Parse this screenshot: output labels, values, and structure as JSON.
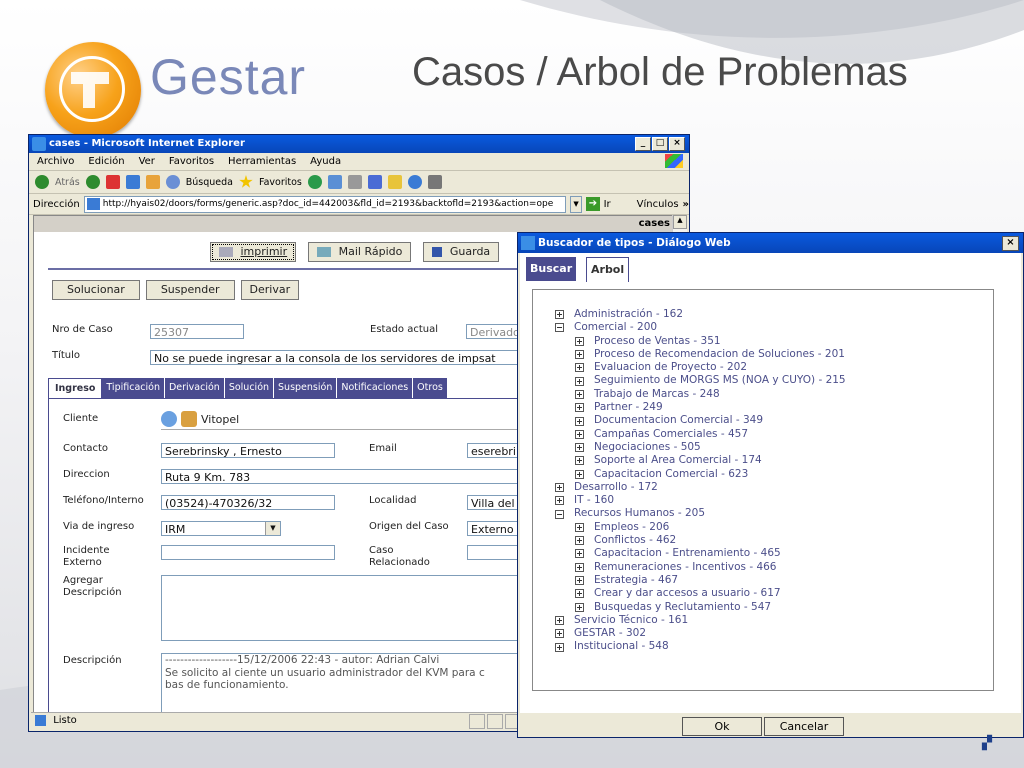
{
  "slide": {
    "brand": "Gestar",
    "title": "Casos / Arbol de Problemas"
  },
  "browser": {
    "window_title": "cases - Microsoft Internet Explorer",
    "menu": [
      "Archivo",
      "Edición",
      "Ver",
      "Favoritos",
      "Herramientas",
      "Ayuda"
    ],
    "toolbar": {
      "back": "Atrás",
      "search": "Búsqueda",
      "favorites": "Favoritos"
    },
    "address_label": "Dirección",
    "address_value": "http://hyais02/doors/forms/generic.asp?doc_id=442003&fld_id=2193&backtofld=2193&action=ope",
    "go_label": "Ir",
    "links_label": "Vínculos",
    "status": "Listo"
  },
  "form": {
    "header_label": "cases",
    "buttons_top": {
      "print": "imprimir",
      "mail": "Mail Rápido",
      "save": "Guarda"
    },
    "actions": [
      "Solucionar",
      "Suspender",
      "Derivar"
    ],
    "nro_caso_label": "Nro de Caso",
    "nro_caso_value": "25307",
    "estado_label": "Estado actual",
    "estado_value": "Derivado",
    "titulo_label": "Título",
    "titulo_value": "No se puede ingresar a la consola de los servidores de impsat",
    "tabs": [
      "Ingreso",
      "Tipificación",
      "Derivación",
      "Solución",
      "Suspensión",
      "Notificaciones",
      "Otros"
    ],
    "cliente_label": "Cliente",
    "cliente_value": "Vitopel",
    "contacto_label": "Contacto",
    "contacto_value": "Serebrinsky , Ernesto",
    "email_label": "Email",
    "email_value": "eserebri",
    "direccion_label": "Direccion",
    "direccion_value": "Ruta 9 Km. 783",
    "telefono_label": "Teléfono/Interno",
    "telefono_value": "(03524)-470326/32",
    "localidad_label": "Localidad",
    "localidad_value": "Villa del",
    "via_label": "Via de ingreso",
    "via_value": "IRM",
    "origen_label": "Origen del Caso",
    "origen_value": "Externo -",
    "incidente_label_1": "Incidente",
    "incidente_label_2": "Externo",
    "caso_rel_label_1": "Caso",
    "caso_rel_label_2": "Relacionado",
    "agregar_label_1": "Agregar",
    "agregar_label_2": "Descripción",
    "descripcion_label": "Descripción",
    "descripcion_line1": "-------------------15/12/2006 22:43 - autor: Adrian Calvi",
    "descripcion_line2": "Se solicito al ciente un usuario administrador del KVM para c",
    "descripcion_line3": "bas de funcionamiento."
  },
  "dialog": {
    "title": "Buscador de tipos - Diálogo Web",
    "tab_buscar": "Buscar",
    "tab_arbol": "Arbol",
    "tree": [
      {
        "label": "Administración - 162",
        "level": 0,
        "expanded": false
      },
      {
        "label": "Comercial - 200",
        "level": 0,
        "expanded": true
      },
      {
        "label": "Proceso de Ventas - 351",
        "level": 1,
        "expanded": false
      },
      {
        "label": "Proceso de Recomendacion de Soluciones - 201",
        "level": 1,
        "expanded": false
      },
      {
        "label": "Evaluacion de Proyecto - 202",
        "level": 1,
        "expanded": false
      },
      {
        "label": "Seguimiento de MORGS MS (NOA y CUYO) - 215",
        "level": 1,
        "expanded": false
      },
      {
        "label": "Trabajo de Marcas - 248",
        "level": 1,
        "expanded": false
      },
      {
        "label": "Partner - 249",
        "level": 1,
        "expanded": false
      },
      {
        "label": "Documentacion Comercial - 349",
        "level": 1,
        "expanded": false
      },
      {
        "label": "Campañas Comerciales - 457",
        "level": 1,
        "expanded": false
      },
      {
        "label": "Negociaciones - 505",
        "level": 1,
        "expanded": false
      },
      {
        "label": "Soporte al Area Comercial - 174",
        "level": 1,
        "expanded": false
      },
      {
        "label": "Capacitacion Comercial - 623",
        "level": 1,
        "expanded": false
      },
      {
        "label": "Desarrollo - 172",
        "level": 0,
        "expanded": false
      },
      {
        "label": "IT - 160",
        "level": 0,
        "expanded": false
      },
      {
        "label": "Recursos Humanos - 205",
        "level": 0,
        "expanded": true
      },
      {
        "label": "Empleos - 206",
        "level": 1,
        "expanded": false
      },
      {
        "label": "Conflictos - 462",
        "level": 1,
        "expanded": false
      },
      {
        "label": "Capacitacion - Entrenamiento - 465",
        "level": 1,
        "expanded": false
      },
      {
        "label": "Remuneraciones - Incentivos - 466",
        "level": 1,
        "expanded": false
      },
      {
        "label": "Estrategia - 467",
        "level": 1,
        "expanded": false
      },
      {
        "label": "Crear y dar accesos a usuario - 617",
        "level": 1,
        "expanded": false
      },
      {
        "label": "Busquedas y Reclutamiento - 547",
        "level": 1,
        "expanded": false
      },
      {
        "label": "Servicio Técnico - 161",
        "level": 0,
        "expanded": false
      },
      {
        "label": "GESTAR - 302",
        "level": 0,
        "expanded": false
      },
      {
        "label": "Institucional - 548",
        "level": 0,
        "expanded": false
      }
    ],
    "ok_label": "Ok",
    "cancel_label": "Cancelar"
  },
  "colors": {
    "accent": "#4a4b8f",
    "titlebar": "#0a5adf",
    "brand": "#7a88b8",
    "logo": "#f7a21a"
  }
}
